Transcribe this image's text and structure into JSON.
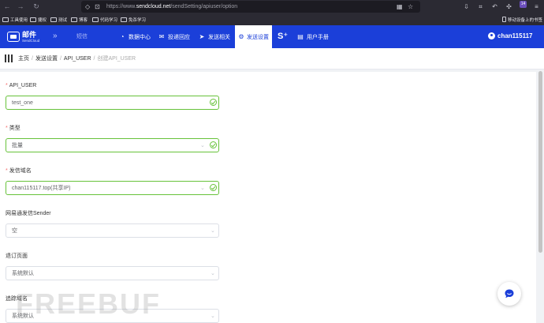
{
  "browser": {
    "url_prefix": "https://www.",
    "url_domain": "sendcloud.net",
    "url_path": "/sendSetting/apiuser/option",
    "extension_badge": "14",
    "bookmarks": [
      "工具使用",
      "捷权",
      "测试",
      "博客",
      "代码学习",
      "免杀学习"
    ],
    "mobile_bookmarks": "移动设备上的书签"
  },
  "header": {
    "logo_title": "邮件",
    "logo_subtitle": "SendCloud",
    "sms_label": "短信",
    "menu": [
      {
        "label": "数据中心",
        "icon": "pie-chart-icon"
      },
      {
        "label": "投递回应",
        "icon": "mail-reply-icon"
      },
      {
        "label": "发送相关",
        "icon": "paper-plane-icon"
      },
      {
        "label": "发送设置",
        "icon": "gear-icon"
      },
      {
        "label": "用户手册",
        "icon": "book-icon"
      }
    ],
    "splus_label": "S⁺",
    "username": "chan115117"
  },
  "breadcrumb": {
    "home": "主页",
    "send_settings": "发送设置",
    "api_user": "API_USER",
    "current": "创建API_USER"
  },
  "form": {
    "api_user": {
      "label": "API_USER",
      "value": "test_one",
      "required": true
    },
    "type": {
      "label": "类型",
      "value": "批量",
      "required": true
    },
    "domain": {
      "label": "发信域名",
      "value": "chan115117.top(共享IP)",
      "required": true
    },
    "sender": {
      "label": "网易通发信Sender",
      "value": "空"
    },
    "unsubscribe": {
      "label": "退订页面",
      "value": "系统默认"
    },
    "tracking_domain": {
      "label": "追踪域名",
      "value": "系统默认"
    }
  },
  "watermark": "FREEBUF",
  "colors": {
    "brand": "#1b3fd9",
    "success": "#67c23a",
    "required": "#f56c6c"
  }
}
